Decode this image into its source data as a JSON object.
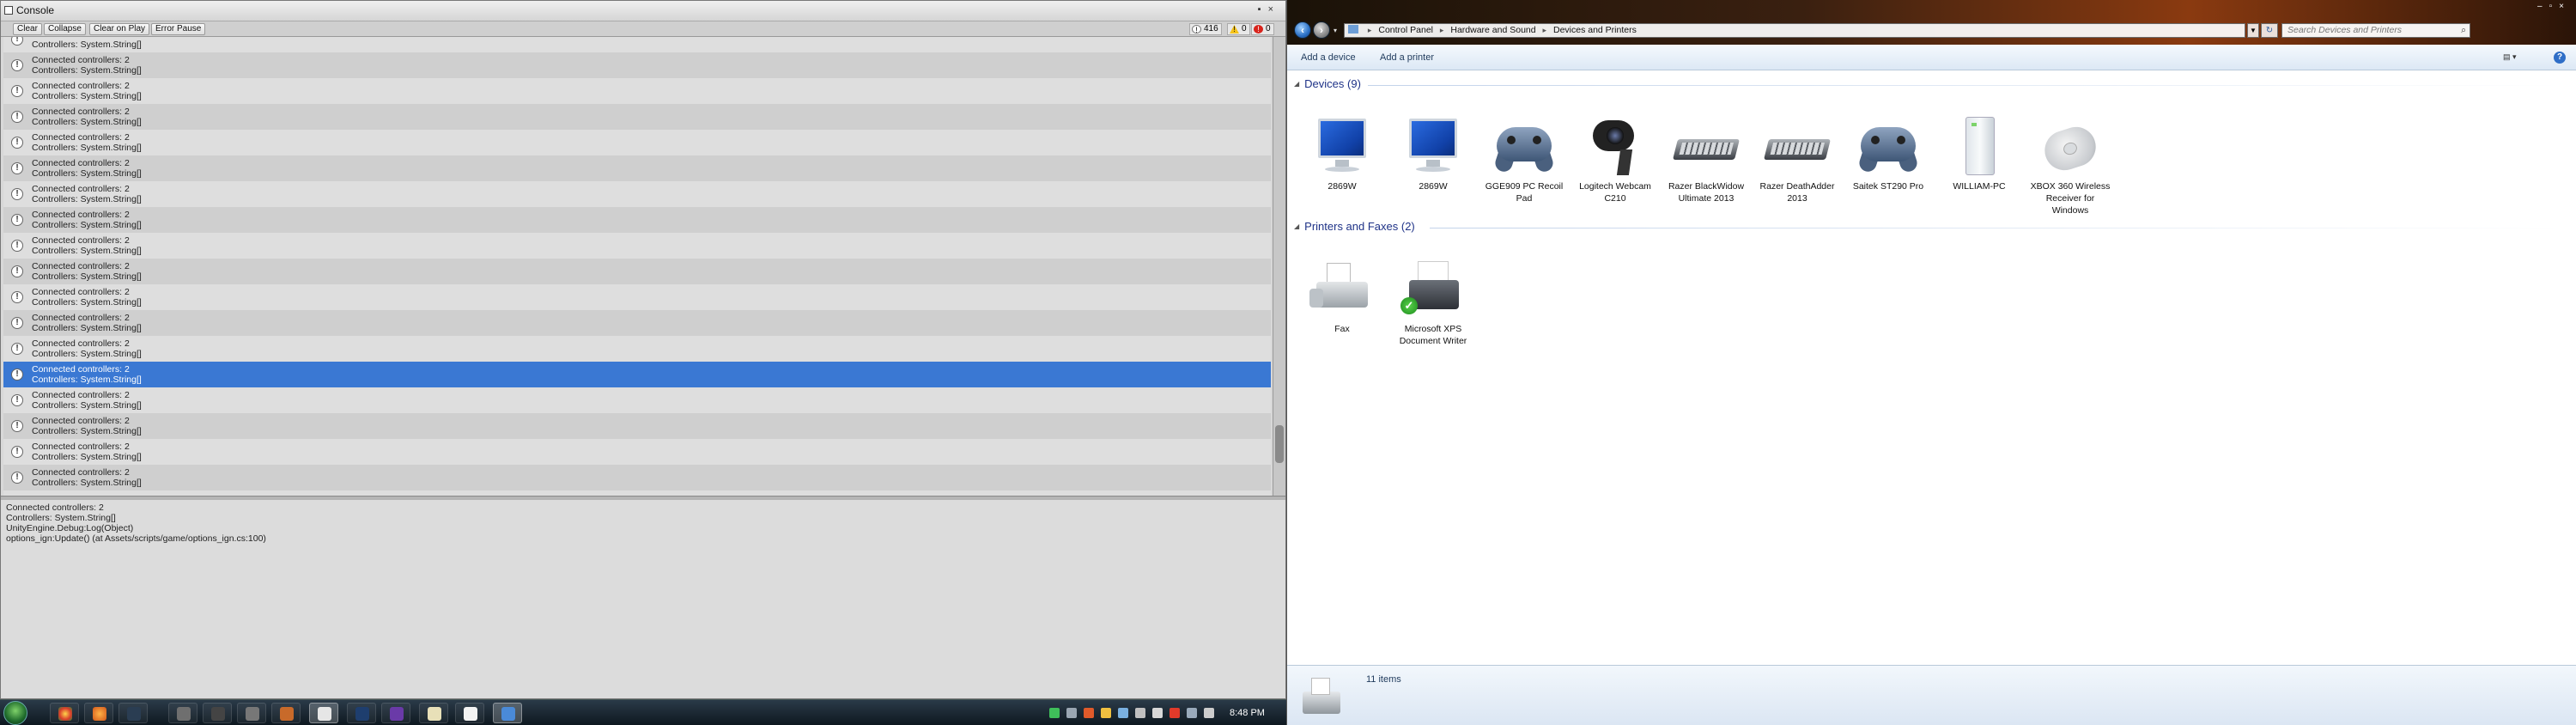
{
  "console": {
    "title": "Console",
    "toolbar": {
      "clear": "Clear",
      "collapse": "Collapse",
      "clear_on_play": "Clear on Play",
      "error_pause": "Error Pause",
      "log_count": "416",
      "warn_count": "0",
      "error_count": "0"
    },
    "log_line1": "Connected controllers: 2",
    "log_line2": "Controllers: System.String[]",
    "visible_rows": 18,
    "selected_row": 13,
    "scroll_fraction": 0.93,
    "detail": [
      "Connected controllers: 2",
      "Controllers: System.String[]",
      "UnityEngine.Debug:Log(Object)",
      "options_ign:Update() (at Assets/scripts/game/options_ign.cs:100)"
    ]
  },
  "taskbar": {
    "clock": "8:48 PM"
  },
  "explorer": {
    "breadcrumb": [
      "Control Panel",
      "Hardware and Sound",
      "Devices and Printers"
    ],
    "search_placeholder": "Search Devices and Printers",
    "commands": {
      "add_device": "Add a device",
      "add_printer": "Add a printer"
    },
    "devices_header": "Devices (9)",
    "devices": [
      {
        "label": "2869W",
        "kind": "monitor"
      },
      {
        "label": "2869W",
        "kind": "monitor"
      },
      {
        "label": "GGE909 PC Recoil Pad",
        "kind": "pad"
      },
      {
        "label": "Logitech Webcam C210",
        "kind": "cam"
      },
      {
        "label": "Razer BlackWidow Ultimate 2013",
        "kind": "kbd"
      },
      {
        "label": "Razer DeathAdder 2013",
        "kind": "kbd"
      },
      {
        "label": "Saitek ST290 Pro",
        "kind": "pad"
      },
      {
        "label": "WILLIAM-PC",
        "kind": "tower"
      },
      {
        "label": "XBOX 360 Wireless Receiver for Windows",
        "kind": "xbox"
      }
    ],
    "printers_header": "Printers and Faxes (2)",
    "printers": [
      {
        "label": "Fax",
        "kind": "fax"
      },
      {
        "label": "Microsoft XPS Document Writer",
        "kind": "prn"
      }
    ],
    "status": "11 items"
  }
}
